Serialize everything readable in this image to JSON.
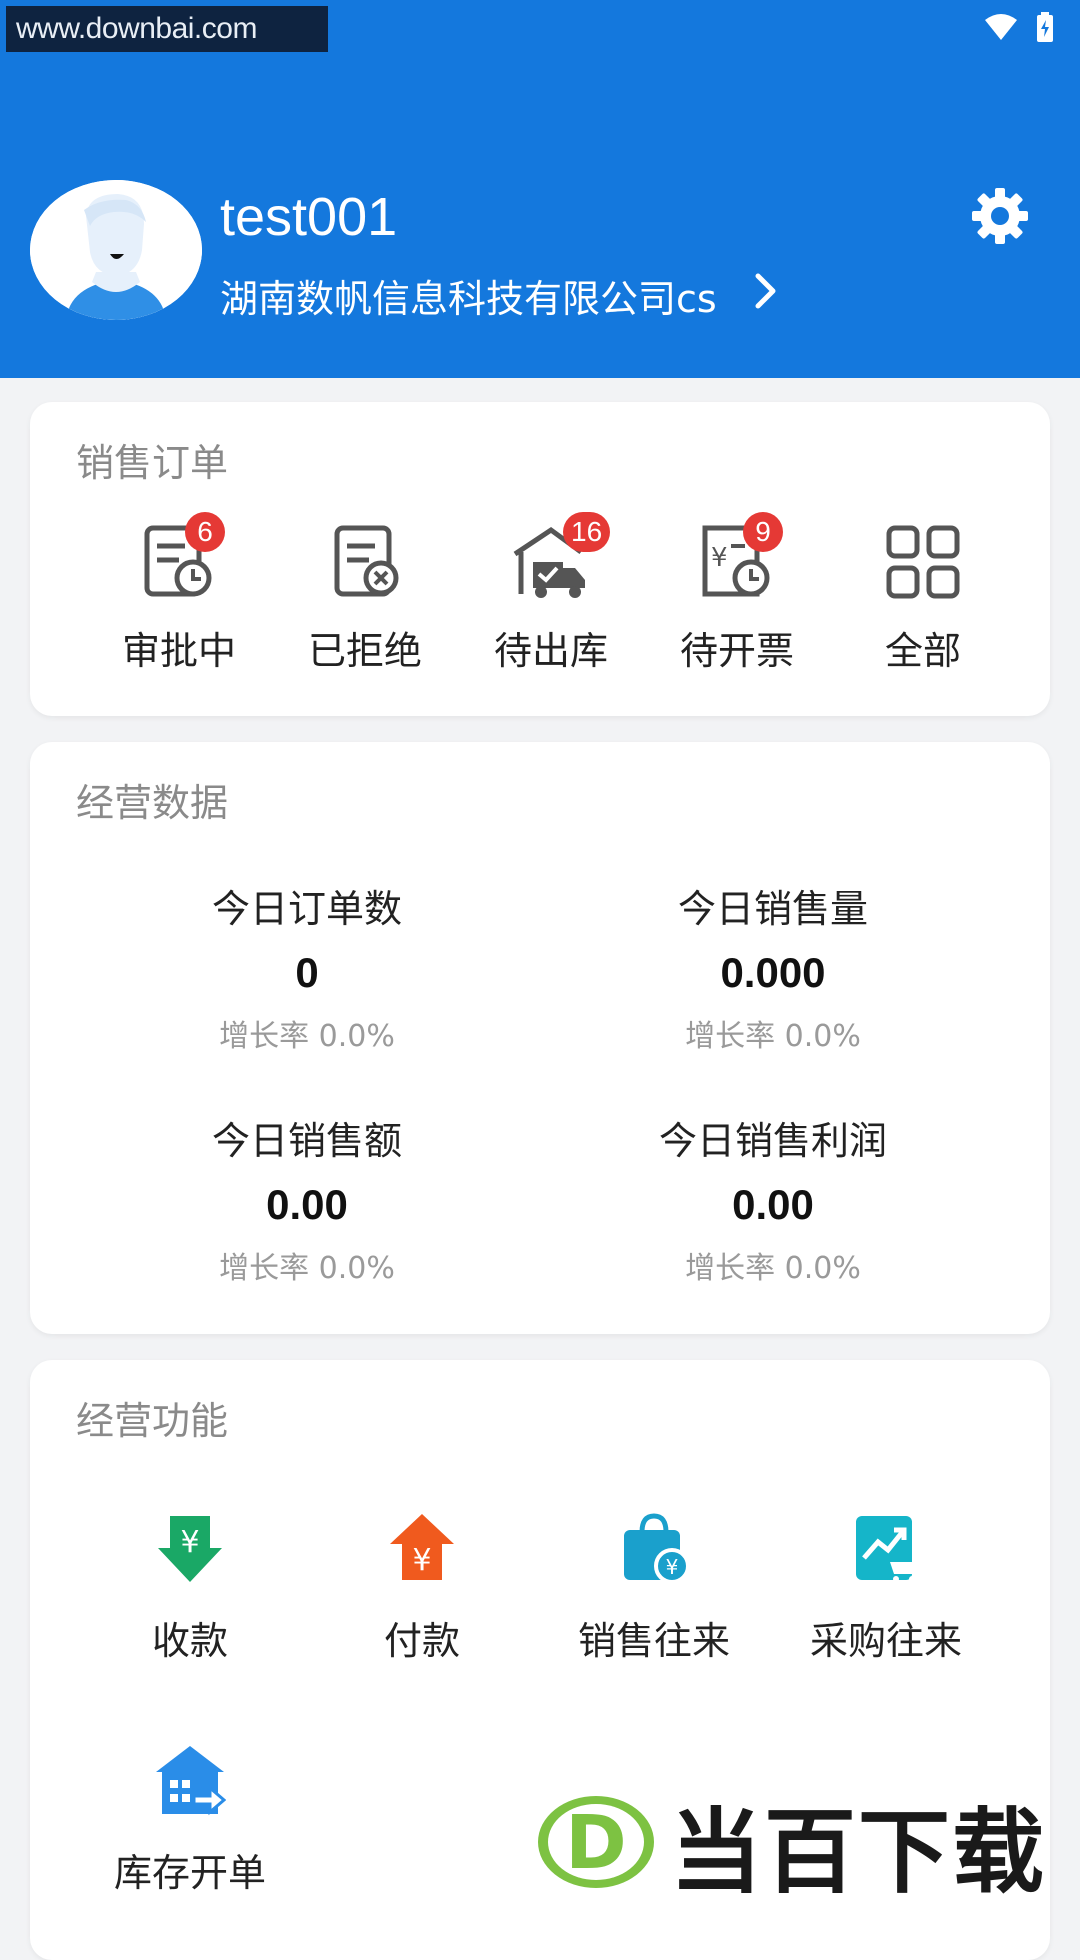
{
  "status_bar": {
    "url_watermark": "www.downbai.com"
  },
  "profile": {
    "username": "test001",
    "company": "湖南数帆信息科技有限公司cs"
  },
  "sales_orders": {
    "title": "销售订单",
    "items": [
      {
        "label": "审批中",
        "badge": "6",
        "icon": "doc-clock-icon"
      },
      {
        "label": "已拒绝",
        "badge": "",
        "icon": "doc-reject-icon"
      },
      {
        "label": "待出库",
        "badge": "16",
        "icon": "warehouse-truck-icon"
      },
      {
        "label": "待开票",
        "badge": "9",
        "icon": "invoice-clock-icon"
      },
      {
        "label": "全部",
        "badge": "",
        "icon": "grid-icon"
      }
    ]
  },
  "business_data": {
    "title": "经营数据",
    "stats": [
      {
        "name": "今日订单数",
        "value": "0",
        "growth": "增长率 0.0%"
      },
      {
        "name": "今日销售量",
        "value": "0.000",
        "growth": "增长率 0.0%"
      },
      {
        "name": "今日销售额",
        "value": "0.00",
        "growth": "增长率 0.0%"
      },
      {
        "name": "今日销售利润",
        "value": "0.00",
        "growth": "增长率 0.0%"
      }
    ]
  },
  "business_functions": {
    "title": "经营功能",
    "items": [
      {
        "label": "收款",
        "icon": "receive-payment-icon",
        "color": "#1aa866"
      },
      {
        "label": "付款",
        "icon": "make-payment-icon",
        "color": "#f05a1e"
      },
      {
        "label": "销售往来",
        "icon": "shopping-bag-icon",
        "color": "#1aa0cc"
      },
      {
        "label": "采购往来",
        "icon": "purchase-chart-icon",
        "color": "#15b5c9"
      },
      {
        "label": "库存开单",
        "icon": "inventory-building-icon",
        "color": "#2a8de8"
      }
    ]
  },
  "watermark_logo": {
    "text": "当百下载"
  },
  "colors": {
    "header": "#1478dd",
    "badge": "#e53935"
  }
}
